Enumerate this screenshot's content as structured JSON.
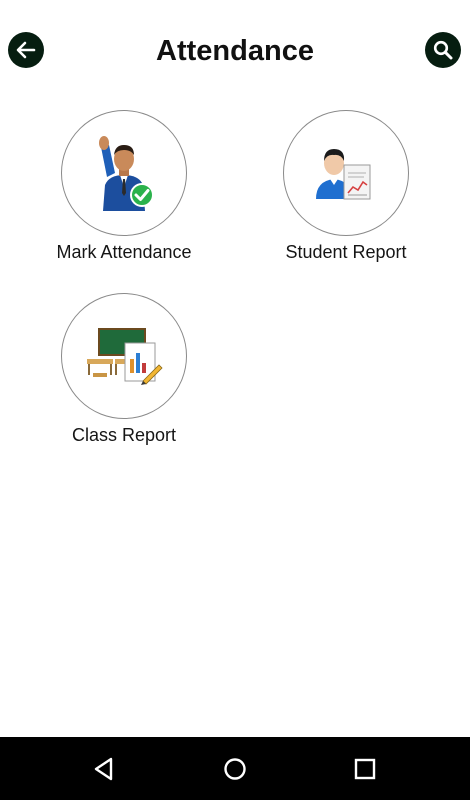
{
  "header": {
    "title": "Attendance",
    "back_icon": "arrow-left-icon",
    "search_icon": "search-icon",
    "button_color": "#061d10"
  },
  "tiles": [
    {
      "label": "Mark Attendance",
      "icon": "raised-hand-student-icon"
    },
    {
      "label": "Student Report",
      "icon": "student-report-icon"
    },
    {
      "label": "Class Report",
      "icon": "classroom-report-icon"
    }
  ],
  "nav_bar": {
    "back_icon": "triangle-back-icon",
    "home_icon": "circle-home-icon",
    "recents_icon": "square-recents-icon"
  }
}
